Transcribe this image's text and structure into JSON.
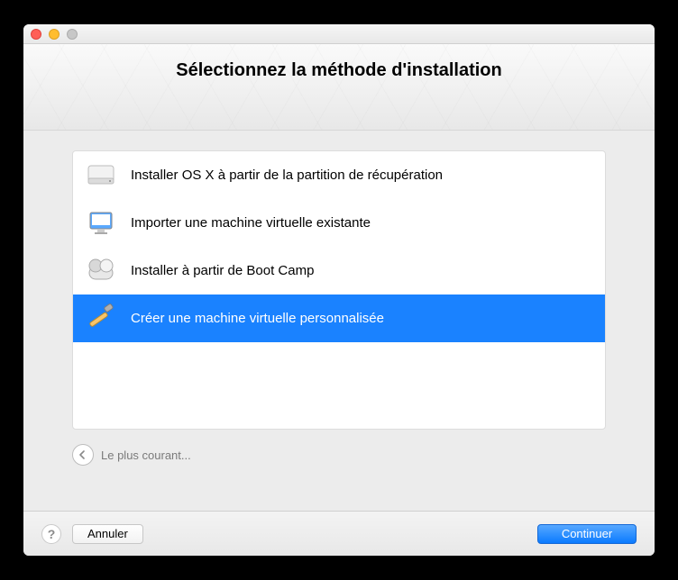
{
  "title": "Sélectionnez la méthode d'installation",
  "options": [
    {
      "label": "Installer OS X à partir de la partition de récupération",
      "icon": "hdd-icon"
    },
    {
      "label": "Importer une machine virtuelle existante",
      "icon": "monitor-icon"
    },
    {
      "label": "Installer à partir de Boot Camp",
      "icon": "bootcamp-icon"
    },
    {
      "label": "Créer une machine virtuelle personnalisée",
      "icon": "customize-icon"
    }
  ],
  "selected_index": 3,
  "nav_back_label": "Le plus courant...",
  "buttons": {
    "cancel": "Annuler",
    "continue": "Continuer"
  }
}
